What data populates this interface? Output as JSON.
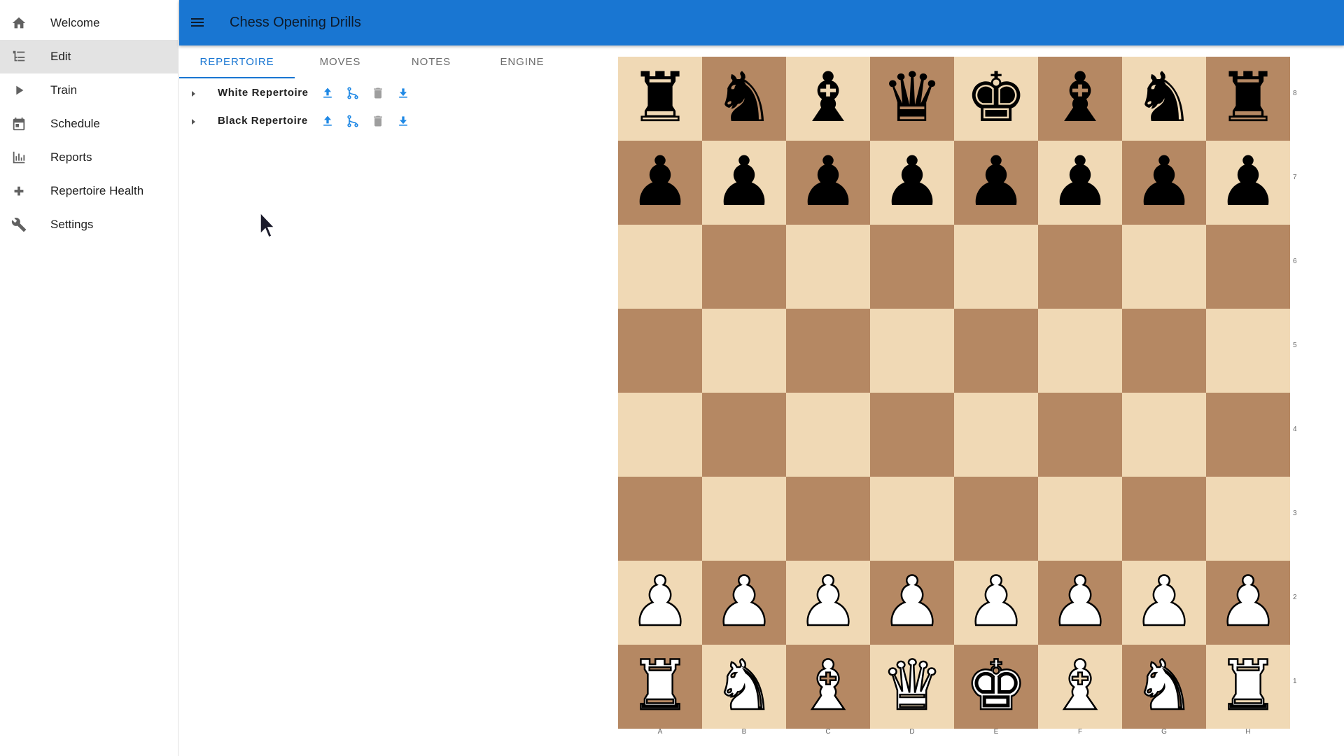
{
  "app": {
    "title": "Chess Opening Drills"
  },
  "sidebar": {
    "items": [
      {
        "label": "Welcome",
        "icon": "home-icon",
        "active": false
      },
      {
        "label": "Edit",
        "icon": "tree-edit-icon",
        "active": true
      },
      {
        "label": "Train",
        "icon": "play-icon",
        "active": false
      },
      {
        "label": "Schedule",
        "icon": "calendar-icon",
        "active": false
      },
      {
        "label": "Reports",
        "icon": "bar-chart-icon",
        "active": false
      },
      {
        "label": "Repertoire Health",
        "icon": "plus-icon",
        "active": false
      },
      {
        "label": "Settings",
        "icon": "wrench-icon",
        "active": false
      }
    ]
  },
  "tabs": [
    {
      "label": "REPERTOIRE",
      "active": true
    },
    {
      "label": "MOVES",
      "active": false
    },
    {
      "label": "NOTES",
      "active": false
    },
    {
      "label": "ENGINE",
      "active": false
    }
  ],
  "repertoires": [
    {
      "label": "White Repertoire"
    },
    {
      "label": "Black Repertoire"
    }
  ],
  "colors": {
    "appbar": "#1976d2",
    "accent": "#1976d2",
    "light_square": "#f0d9b5",
    "dark_square": "#b58863",
    "disabled_icon": "#9e9e9e"
  },
  "board": {
    "files": [
      "A",
      "B",
      "C",
      "D",
      "E",
      "F",
      "G",
      "H"
    ],
    "ranks": [
      "8",
      "7",
      "6",
      "5",
      "4",
      "3",
      "2",
      "1"
    ],
    "position": [
      [
        "r",
        "n",
        "b",
        "q",
        "k",
        "b",
        "n",
        "r"
      ],
      [
        "p",
        "p",
        "p",
        "p",
        "p",
        "p",
        "p",
        "p"
      ],
      [
        "",
        "",
        "",
        "",
        "",
        "",
        "",
        ""
      ],
      [
        "",
        "",
        "",
        "",
        "",
        "",
        "",
        ""
      ],
      [
        "",
        "",
        "",
        "",
        "",
        "",
        "",
        ""
      ],
      [
        "",
        "",
        "",
        "",
        "",
        "",
        "",
        ""
      ],
      [
        "P",
        "P",
        "P",
        "P",
        "P",
        "P",
        "P",
        "P"
      ],
      [
        "R",
        "N",
        "B",
        "Q",
        "K",
        "B",
        "N",
        "R"
      ]
    ]
  }
}
